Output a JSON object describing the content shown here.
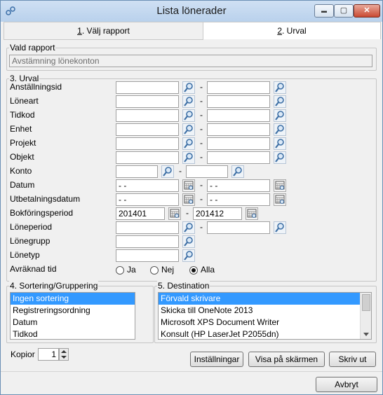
{
  "window": {
    "title": "Lista lönerader",
    "minimize": "▬",
    "maximize": "▢",
    "close": "✕",
    "icon": "app-icon"
  },
  "tabs": [
    {
      "prefix": "1",
      "label": ". Välj rapport"
    },
    {
      "prefix": "2",
      "label": ". Urval"
    }
  ],
  "report": {
    "group_title": "Vald rapport",
    "value": "Avstämning lönekonton"
  },
  "urval": {
    "group_title": "3. Urval",
    "fields": {
      "anstallningsid": "Anställningsid",
      "loneart": "Löneart",
      "tidkod": "Tidkod",
      "enhet": "Enhet",
      "projekt": "Projekt",
      "objekt": "Objekt",
      "konto": "Konto",
      "datum": "Datum",
      "utbetalningsdatum": "Utbetalningsdatum",
      "bokforingsperiod": "Bokföringsperiod",
      "loneperiod": "Löneperiod",
      "lonegrupp": "Lönegrupp",
      "lonetyp": "Lönetyp",
      "avraknad": "Avräknad tid"
    },
    "dash": "-",
    "date_mask": "  -  -",
    "bokforing_from": "201401",
    "bokforing_to": "201412",
    "radio": {
      "ja": "Ja",
      "nej": "Nej",
      "alla": "Alla",
      "selected": "Alla"
    }
  },
  "sorting": {
    "group_title": "4. Sortering/Gruppering",
    "items": [
      "Ingen sortering",
      "Registreringsordning",
      "Datum",
      "Tidkod"
    ],
    "selected": "Ingen sortering"
  },
  "destination": {
    "group_title": "5. Destination",
    "items": [
      "Förvald skrivare",
      "Skicka till OneNote 2013",
      "Microsoft XPS Document Writer",
      "Konsult (HP LaserJet P2055dn)"
    ],
    "selected": "Förvald skrivare"
  },
  "kopior": {
    "label": "Kopior",
    "value": "1"
  },
  "buttons": {
    "installningar": "Inställningar",
    "visa": "Visa på skärmen",
    "skriv": "Skriv ut",
    "avbryt": "Avbryt"
  }
}
